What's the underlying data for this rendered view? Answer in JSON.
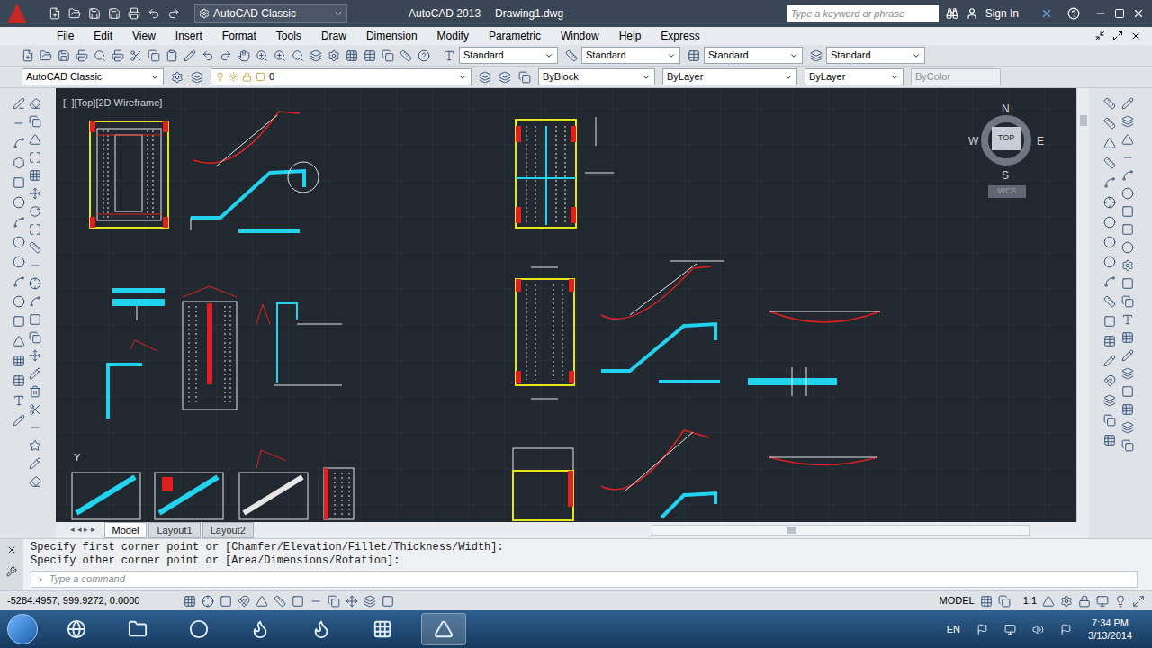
{
  "title_bar": {
    "workspace": "AutoCAD Classic",
    "app": "AutoCAD 2013",
    "file": "Drawing1.dwg",
    "search_placeholder": "Type a keyword or phrase",
    "sign_in": "Sign In"
  },
  "menu": [
    "File",
    "Edit",
    "View",
    "Insert",
    "Format",
    "Tools",
    "Draw",
    "Dimension",
    "Modify",
    "Parametric",
    "Window",
    "Help",
    "Express"
  ],
  "styles": [
    "Standard",
    "Standard",
    "Standard",
    "Standard"
  ],
  "properties_bar": {
    "workspace": "AutoCAD Classic",
    "layer": "0",
    "color": "ByBlock",
    "linetype": "ByLayer",
    "lineweight": "ByLayer",
    "plotstyle": "ByColor"
  },
  "viewport": {
    "label": "[−][Top][2D Wireframe]"
  },
  "viewcube": {
    "north": "N",
    "south": "S",
    "east": "E",
    "west": "W",
    "face": "TOP",
    "ucs": "WCS"
  },
  "ucs_label": "Y",
  "layout_tabs": [
    {
      "label": "Model",
      "selected": true
    },
    {
      "label": "Layout1",
      "selected": false
    },
    {
      "label": "Layout2",
      "selected": false
    }
  ],
  "command": {
    "history": [
      "Specify first corner point or [Chamfer/Elevation/Fillet/Thickness/Width]:",
      "Specify other corner point or [Area/Dimensions/Rotation]:"
    ],
    "placeholder": "Type a command"
  },
  "status_bar": {
    "coordinates": "-5284.4957, 999.9272, 0.0000",
    "space": "MODEL",
    "scale": "1:1"
  },
  "taskbar": {
    "language": "EN",
    "time": "7:34 PM",
    "date": "3/13/2014"
  }
}
